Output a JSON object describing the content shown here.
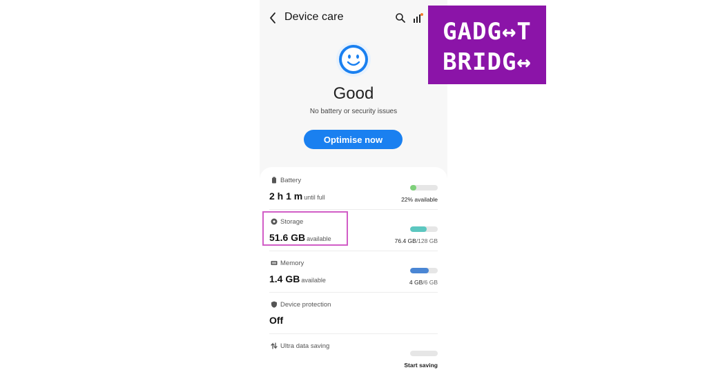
{
  "header": {
    "title": "Device care",
    "back_icon": "back-arrow-icon",
    "search_icon": "search-icon",
    "stats_icon": "stats-icon"
  },
  "status": {
    "face_icon": "smiley-face-icon",
    "headline": "Good",
    "subtitle": "No battery or security issues",
    "action_label": "Optimise now",
    "accent_color": "#1a80f0"
  },
  "items": [
    {
      "label": "Battery",
      "icon": "battery-icon",
      "value": "2 h 1 m",
      "unit": "until full",
      "right_text": "22% available",
      "right_muted": "",
      "fill": 0.22,
      "fill_color": "#7ed07a"
    },
    {
      "label": "Storage",
      "icon": "storage-icon",
      "value": "51.6 GB",
      "unit": "available",
      "right_text": "76.4 GB",
      "right_muted": "/128 GB",
      "fill": 0.6,
      "fill_color": "#5cc7c0"
    },
    {
      "label": "Memory",
      "icon": "memory-icon",
      "value": "1.4 GB",
      "unit": "available",
      "right_text": "4 GB",
      "right_muted": "/6 GB",
      "fill": 0.67,
      "fill_color": "#4a86d4"
    },
    {
      "label": "Device protection",
      "icon": "shield-icon",
      "value": "Off",
      "unit": "",
      "right_text": "",
      "right_muted": ""
    },
    {
      "label": "Ultra data saving",
      "icon": "data-saving-icon",
      "value": "",
      "unit": "",
      "right_text": "Start saving",
      "right_muted": "",
      "fill": 0,
      "fill_color": "#e6e6e6"
    }
  ],
  "logo": {
    "line1": "GADG↔T",
    "line2": "BRIDG↔",
    "background": "#8b14a8"
  }
}
